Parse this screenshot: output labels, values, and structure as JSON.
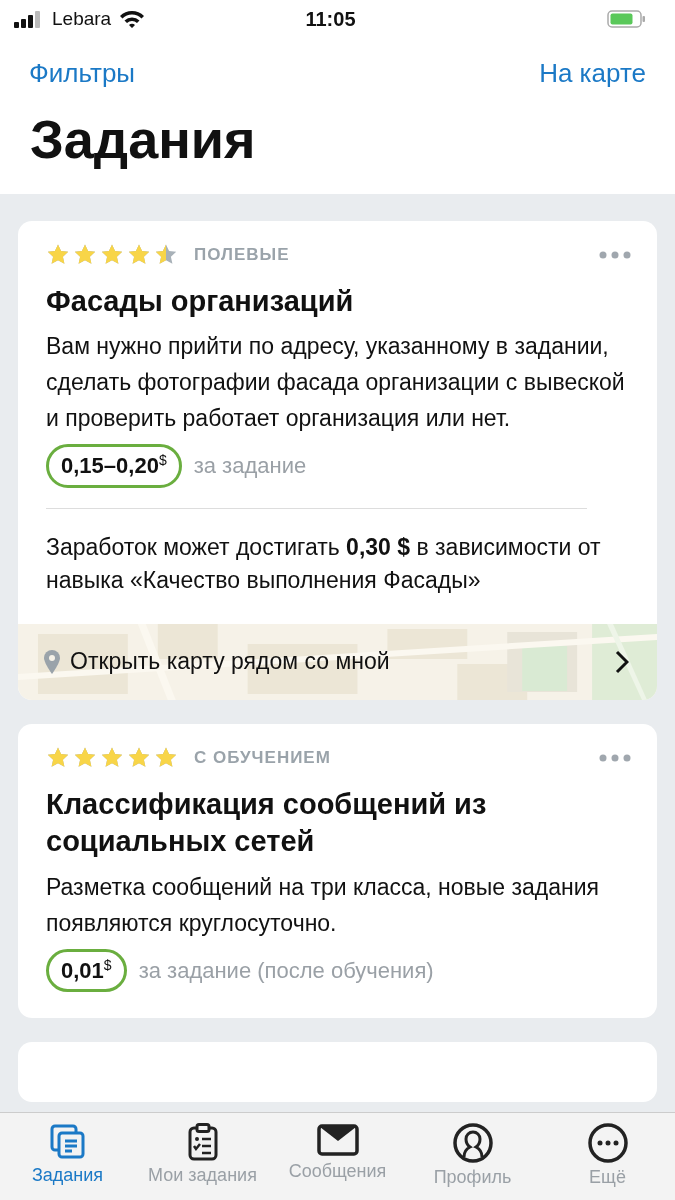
{
  "status_bar": {
    "carrier": "Lebara",
    "time": "11:05"
  },
  "nav": {
    "left": "Фильтры",
    "right": "На карте"
  },
  "title": "Задания",
  "cards": [
    {
      "stars": 4.5,
      "category": "ПОЛЕВЫЕ",
      "title": "Фасады организаций",
      "description": "Вам нужно прийти по адресу, указанному в задании, сделать фотографии фасада организации с вывеской и проверить работает организация или нет.",
      "price": "0,15–0,20",
      "currency": "$",
      "price_note": "за задание",
      "earnings": "Заработок может достигать **0,30 $** в зависимости от навыка «Качество выполнения Фасады»",
      "map_link": "Открыть карту рядом со мной"
    },
    {
      "stars": 5,
      "category": "С ОБУЧЕНИЕМ",
      "title": "Классификация сообщений из социальных сетей",
      "description": "Разметка сообщений на три класса, новые задания появляются круглосуточно.",
      "price": "0,01",
      "currency": "$",
      "price_note": "за задание (после обучения)"
    }
  ],
  "tabs": [
    {
      "kind": "tasks",
      "label": "Задания",
      "selected": true
    },
    {
      "kind": "my",
      "label": "Мои задания",
      "selected": false
    },
    {
      "kind": "messages",
      "label": "Сообщения",
      "selected": false
    },
    {
      "kind": "profile",
      "label": "Профиль",
      "selected": false
    },
    {
      "kind": "more",
      "label": "Ещё",
      "selected": false
    }
  ]
}
